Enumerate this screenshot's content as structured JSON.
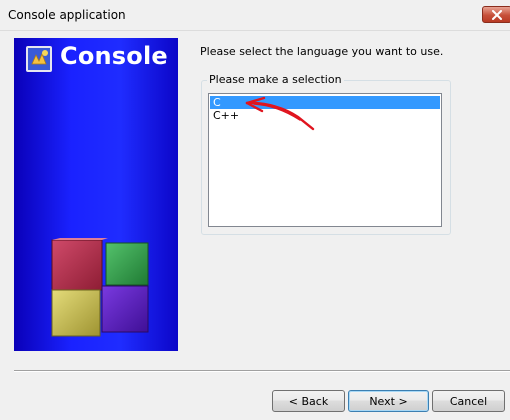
{
  "window": {
    "title": "Console application"
  },
  "banner": {
    "title": "Console",
    "logo_icon": "codeblocks-logo-icon",
    "cubes_icon": "codeblocks-cubes-icon"
  },
  "main": {
    "prompt": "Please select the language you want to use.",
    "group_label": "Please make a selection",
    "languages": [
      {
        "label": "C",
        "selected": true
      },
      {
        "label": "C++",
        "selected": false
      }
    ],
    "selection_color": "#3399ff",
    "annotation_color": "#e0141e"
  },
  "buttons": {
    "back": "< Back",
    "next": "Next >",
    "cancel": "Cancel"
  }
}
